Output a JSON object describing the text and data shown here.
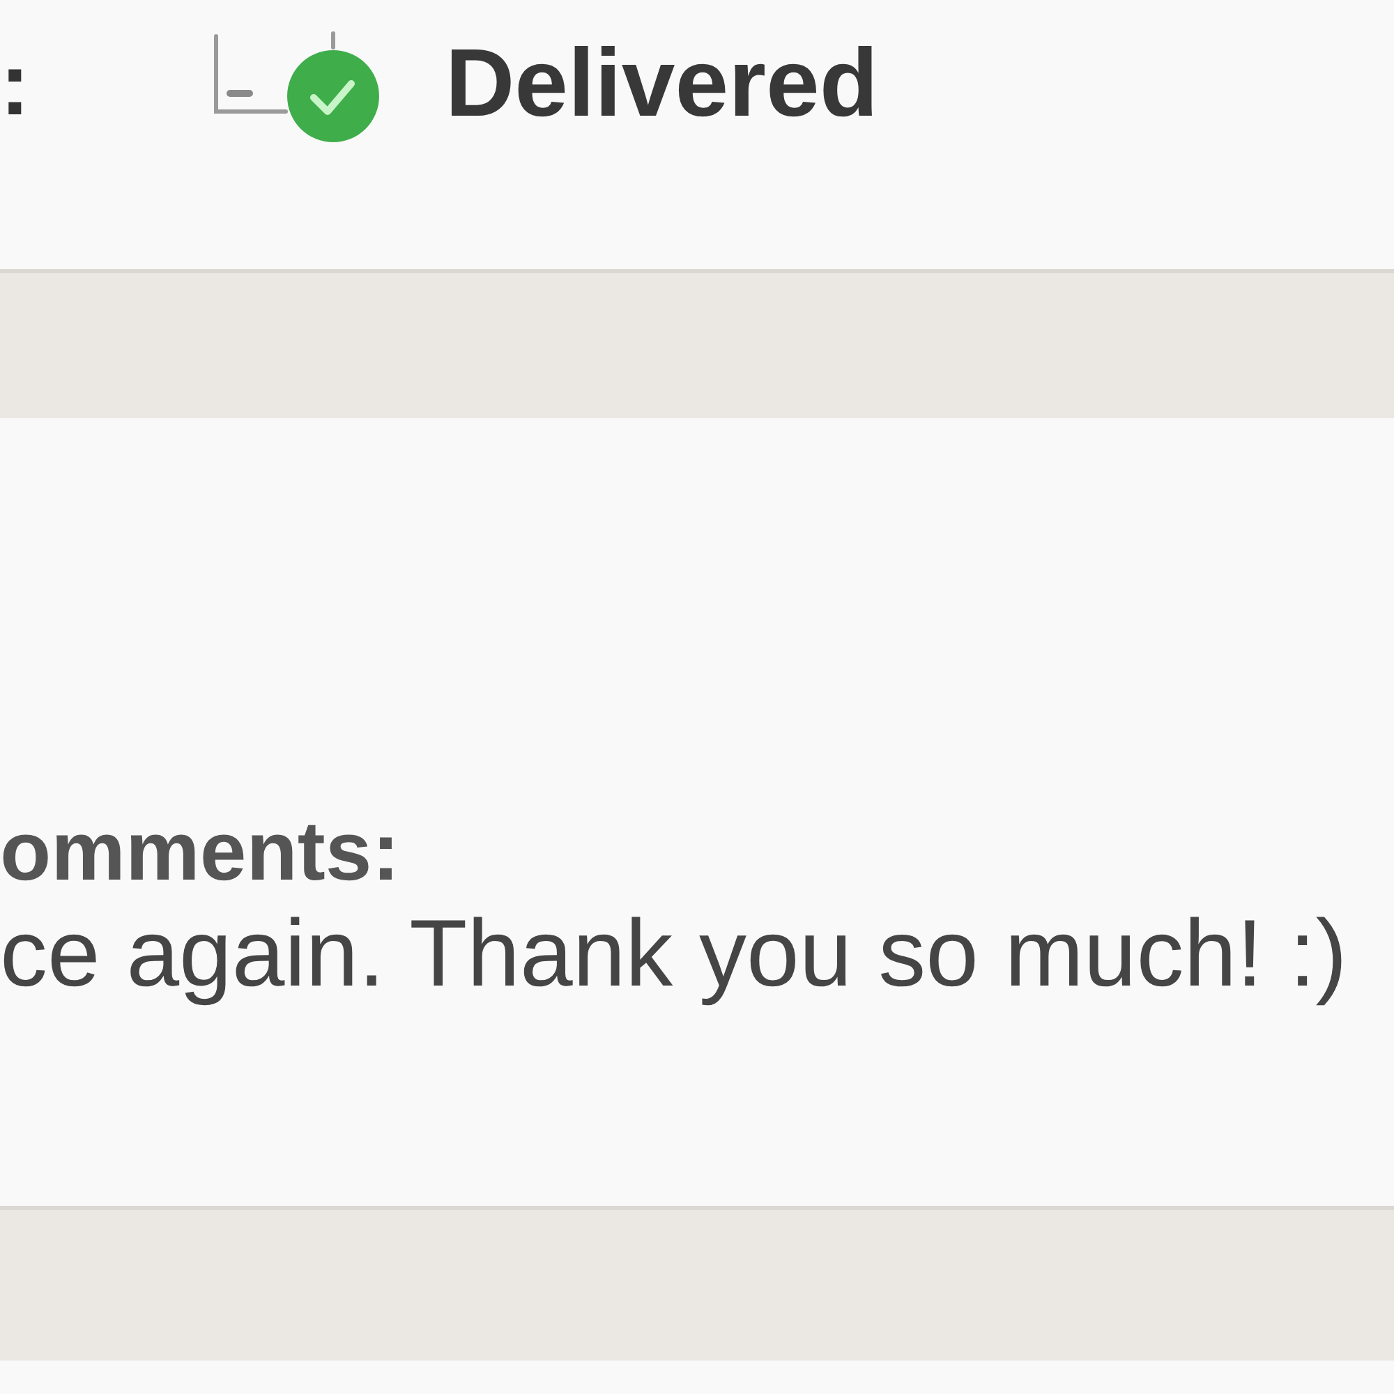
{
  "status": {
    "label": ":",
    "value": "Delivered"
  },
  "comments": {
    "label": "omments:",
    "text": "ce again. Thank you so much! :)"
  }
}
